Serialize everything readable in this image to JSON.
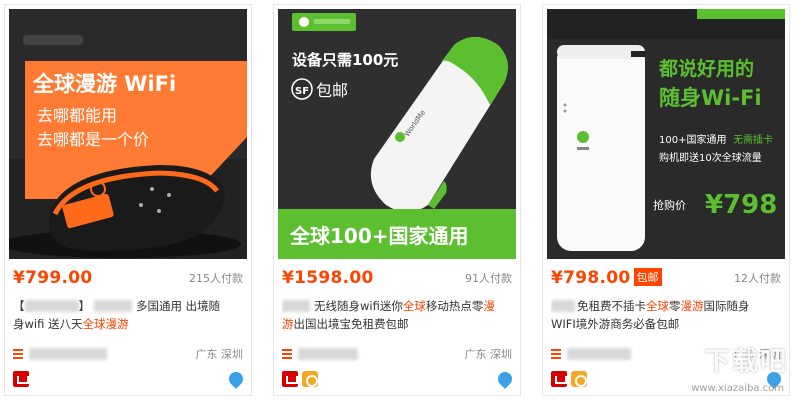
{
  "products": [
    {
      "price": "¥799.00",
      "sales": "215人付款",
      "title_l1_a": "【",
      "title_l1_b": "】",
      "title_l1_c": "多国通用 出境随",
      "title_l2_a": "身wifi 送八天",
      "title_l2_hl": "全球漫游",
      "location": "广东 深圳",
      "image": {
        "headline": "全球漫游 WiFi",
        "line1": "去哪都能用",
        "line2": "去哪都是一个价"
      }
    },
    {
      "price": "¥1598.00",
      "sales": "91人付款",
      "title_l1_a": "无线随身wifi迷你",
      "title_l1_hl": "全球",
      "title_l1_b": "移动热点零",
      "title_l1_hl2": "漫",
      "title_l2_hl": "游",
      "title_l2_a": "出国出境宝免租费包邮",
      "location": "广东 深圳",
      "image": {
        "line1": "设备只需100元",
        "sf": "SF",
        "line2": "包邮",
        "brand": "WorldMe",
        "banner": "全球100+国家通用"
      }
    },
    {
      "price": "¥798.00",
      "badge": "包邮",
      "sales": "12人付款",
      "title_l1_a": "免租费不插卡",
      "title_l1_hl": "全球",
      "title_l1_b": "零",
      "title_l1_hl2": "漫游",
      "title_l1_c": "国际随身",
      "title_l2_a": "WIFI境外游商务必备包邮",
      "location": "广东 深圳",
      "image": {
        "headline1": "都说好用的",
        "headline2": "随身Wi-Fi",
        "feat_a": "100+国家通用",
        "feat_b": "无需插卡",
        "feat_c": "购机即送10次全球流量",
        "deal": "抢购价",
        "deal_price": "¥798"
      }
    }
  ],
  "watermark": {
    "main": "下载吧",
    "url": "www.xiazaiba.com"
  }
}
